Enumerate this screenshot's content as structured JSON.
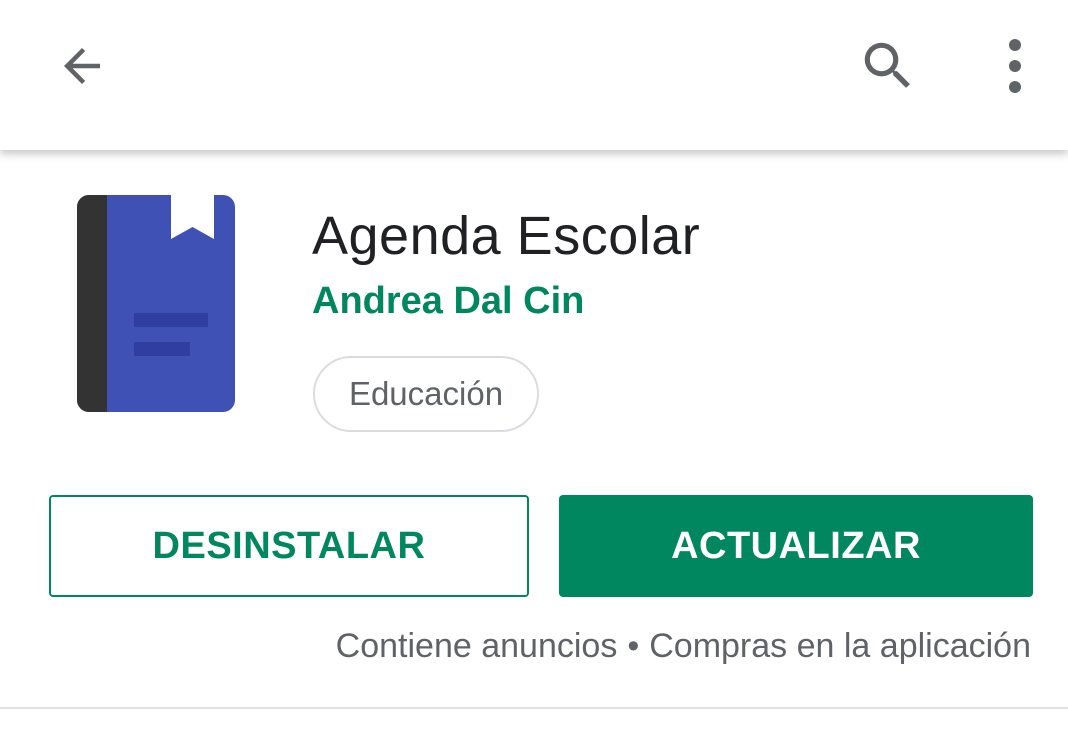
{
  "toolbar": {
    "back_icon": "arrow-back-icon",
    "search_icon": "search-icon",
    "more_icon": "more-vert-icon"
  },
  "app": {
    "title": "Agenda Escolar",
    "developer": "Andrea Dal Cin",
    "category": "Educación",
    "icon": "book-bookmark-icon"
  },
  "actions": {
    "uninstall_label": "DESINSTALAR",
    "update_label": "ACTUALIZAR"
  },
  "notes": {
    "ads": "Contiene anuncios",
    "separator": "•",
    "purchases": "Compras en la aplicación"
  },
  "colors": {
    "accent": "#01875f",
    "title_text": "#202124",
    "secondary_text": "#5f6368",
    "icon_blue": "#3f51b5",
    "icon_spine": "#333333"
  }
}
